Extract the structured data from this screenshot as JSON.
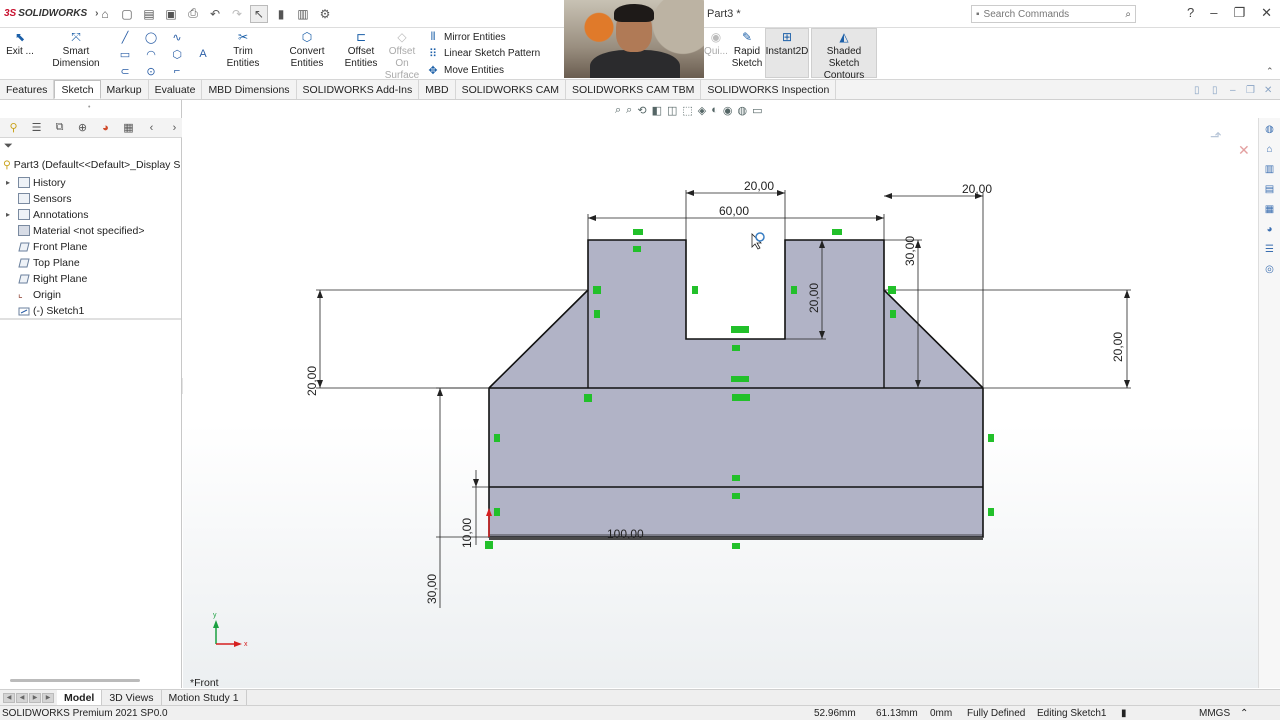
{
  "app": {
    "logo_ds": "3S",
    "logo_name": "SOLIDWORKS",
    "doc_title": "Part3 *",
    "search_placeholder": "Search Commands"
  },
  "ribbon": {
    "exit_label": "Exit ...",
    "smart_dimension": "Smart Dimension",
    "trim_entities": "Trim Entities",
    "convert_entities": "Convert Entities",
    "offset_entities_1": "Offset",
    "offset_entities_2": "Entities",
    "offset_on_surface_1": "Offset On",
    "offset_on_surface_2": "Surface",
    "mirror_entities": "Mirror Entities",
    "linear_sketch_pattern": "Linear Sketch Pattern",
    "move_entities": "Move Entities",
    "quick_snaps": "Qui...",
    "rapid_sketch_1": "Rapid",
    "rapid_sketch_2": "Sketch",
    "instant2d": "Instant2D",
    "shaded_contours_1": "Shaded Sketch",
    "shaded_contours_2": "Contours"
  },
  "tabs": [
    {
      "label": "Features"
    },
    {
      "label": "Sketch"
    },
    {
      "label": "Markup"
    },
    {
      "label": "Evaluate"
    },
    {
      "label": "MBD Dimensions"
    },
    {
      "label": "SOLIDWORKS Add-Ins"
    },
    {
      "label": "MBD"
    },
    {
      "label": "SOLIDWORKS CAM"
    },
    {
      "label": "SOLIDWORKS CAM TBM"
    },
    {
      "label": "SOLIDWORKS Inspection"
    }
  ],
  "tree": {
    "root": "Part3  (Default<<Default>_Display S",
    "items": [
      {
        "label": "History"
      },
      {
        "label": "Sensors"
      },
      {
        "label": "Annotations"
      },
      {
        "label": "Material <not specified>"
      },
      {
        "label": "Front Plane"
      },
      {
        "label": "Top Plane"
      },
      {
        "label": "Right Plane"
      },
      {
        "label": "Origin"
      },
      {
        "label": "(-) Sketch1"
      }
    ]
  },
  "dimensions": {
    "top_slot": "20,00",
    "top_width": "60,00",
    "right_top": "20,00",
    "right_height_30": "30,00",
    "slot_depth": "20,00",
    "left_height": "20,00",
    "right_height": "20,00",
    "base_width": "100,00",
    "base_small": "10,00",
    "base_total": "30,00"
  },
  "view_label": "*Front",
  "bottom_tabs": [
    {
      "label": "Model"
    },
    {
      "label": "3D Views"
    },
    {
      "label": "Motion Study 1"
    }
  ],
  "status": {
    "product": "SOLIDWORKS Premium 2021 SP0.0",
    "x": "52.96mm",
    "y": "61.13mm",
    "z": "0mm",
    "state": "Fully Defined",
    "editing": "Editing Sketch1",
    "units": "MMGS"
  },
  "colors": {
    "logo_red": "#c8102e",
    "sketch_fill": "#a9abc0",
    "relation_green": "#22c02a"
  }
}
